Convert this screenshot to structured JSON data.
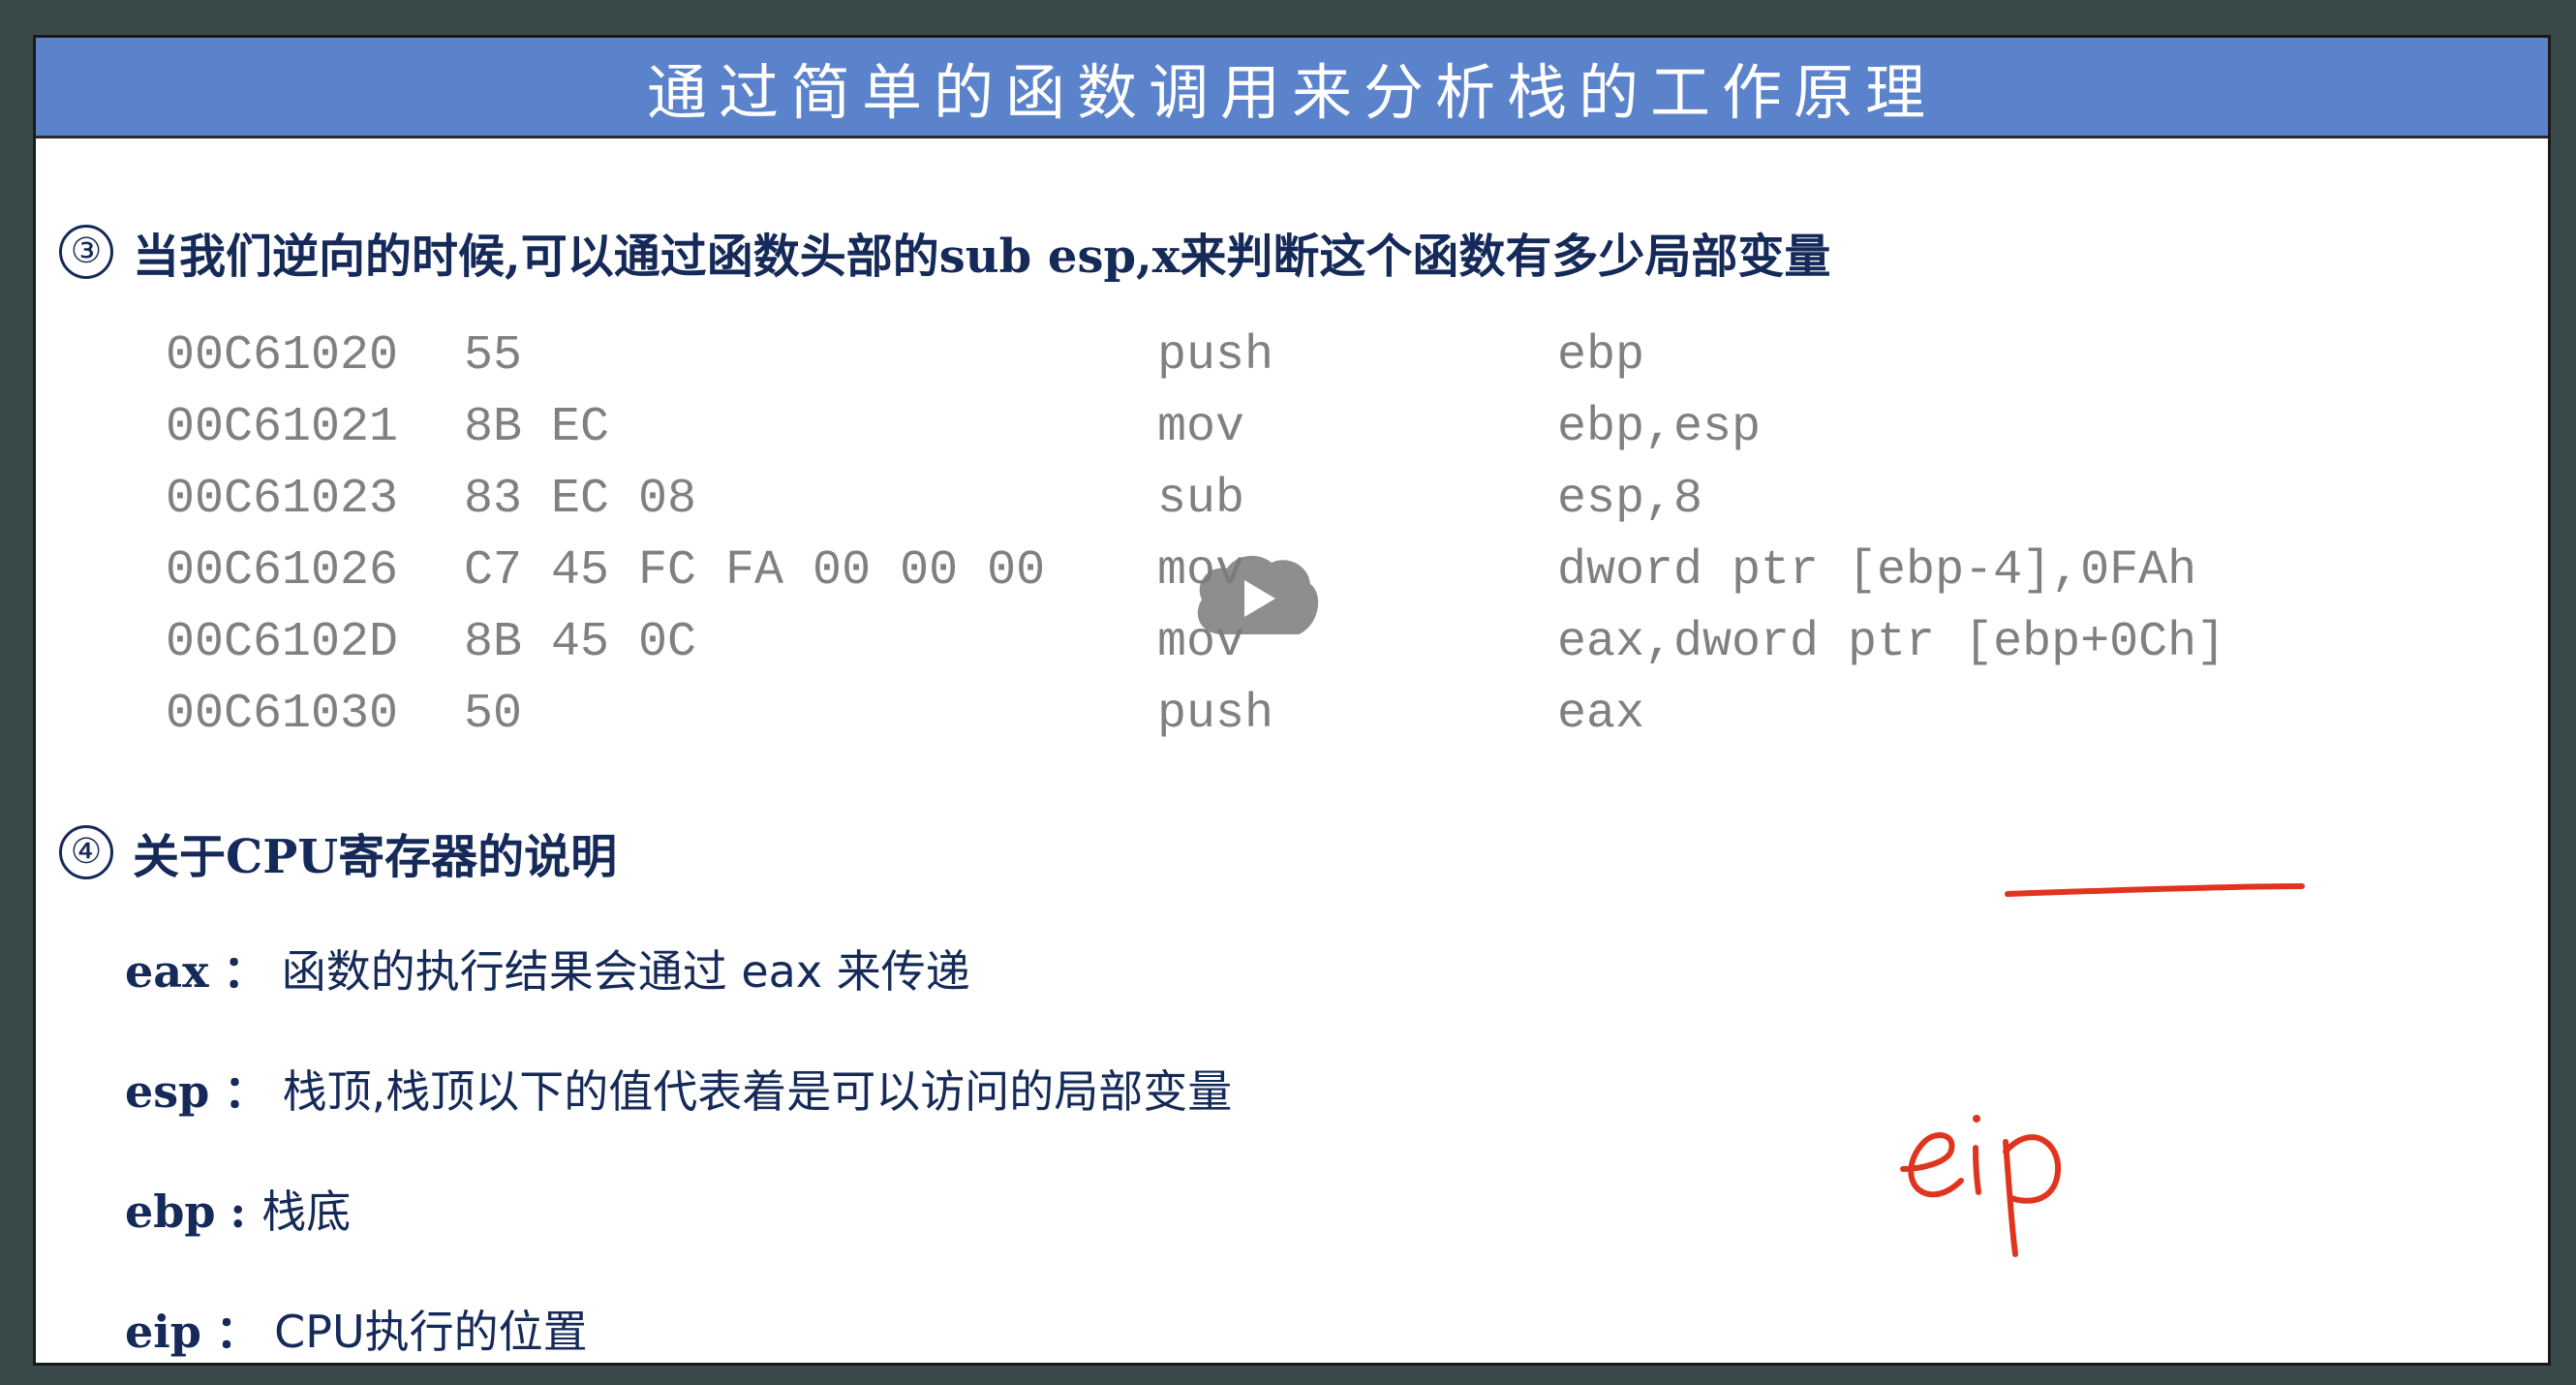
{
  "slide": {
    "title": "通过简单的函数调用来分析栈的工作原理"
  },
  "section3": {
    "number": "③",
    "text": "当我们逆向的时候,可以通过函数头部的sub esp,x来判断这个函数有多少局部变量"
  },
  "code": [
    {
      "addr": "00C61020",
      "bytes": "55",
      "op": "push",
      "args": "ebp"
    },
    {
      "addr": "00C61021",
      "bytes": "8B EC",
      "op": "mov",
      "args": "ebp,esp"
    },
    {
      "addr": "00C61023",
      "bytes": "83 EC 08",
      "op": "sub",
      "args": "esp,8"
    },
    {
      "addr": "00C61026",
      "bytes": "C7 45 FC FA 00 00 00",
      "op": "mov",
      "args": "dword ptr [ebp-4],0FAh"
    },
    {
      "addr": "00C6102D",
      "bytes": "8B 45 0C",
      "op": "mov",
      "args": "eax,dword ptr [ebp+0Ch]"
    },
    {
      "addr": "00C61030",
      "bytes": "50",
      "op": "push",
      "args": "eax"
    }
  ],
  "section4": {
    "number": "④",
    "text": "关于CPU寄存器的说明"
  },
  "registers": [
    {
      "name": "eax",
      "sep": "：",
      "desc": "函数的执行结果会通过 eax 来传递"
    },
    {
      "name": "esp",
      "sep": "：",
      "desc": "栈顶,栈顶以下的值代表着是可以访问的局部变量"
    },
    {
      "name": "ebp",
      "sep": ": ",
      "desc": "栈底"
    },
    {
      "name": "eip",
      "sep": "：",
      "desc": "CPU执行的位置"
    }
  ],
  "annotation": {
    "handwritten": "eip",
    "color": "#e0341e"
  },
  "icons": {
    "play": "play-icon"
  },
  "colors": {
    "title_bar": "#5b83cc",
    "heading_text": "#152a58",
    "code_text": "#808080"
  }
}
